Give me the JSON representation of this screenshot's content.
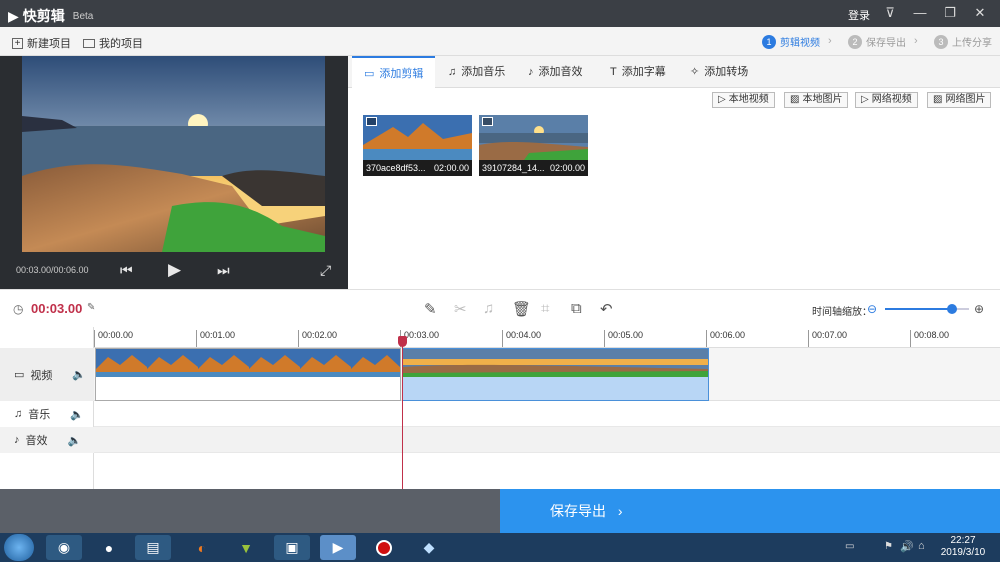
{
  "app": {
    "title": "快剪辑",
    "beta": "Beta",
    "login": "登录"
  },
  "toolbar": {
    "new_project": "新建项目",
    "my_projects": "我的项目",
    "steps": [
      {
        "num": "1",
        "label": "剪辑视频"
      },
      {
        "num": "2",
        "label": "保存导出"
      },
      {
        "num": "3",
        "label": "上传分享"
      }
    ]
  },
  "preview": {
    "time": "00:03.00/00:06.00"
  },
  "tabs": [
    "添加剪辑",
    "添加音乐",
    "添加音效",
    "添加字幕",
    "添加转场"
  ],
  "sources": [
    "本地视频",
    "本地图片",
    "网络视频",
    "网络图片"
  ],
  "clips": [
    {
      "name": "370ace8df53...",
      "duration": "02:00.00"
    },
    {
      "name": "39107284_14...",
      "duration": "02:00.00"
    }
  ],
  "editbar": {
    "current_time": "00:03.00",
    "zoom_label": "时间轴缩放：",
    "zoom_level": 0.8
  },
  "ruler": [
    "00:00.00",
    "00:01.00",
    "00:02.00",
    "00:03.00",
    "00:04.00",
    "00:05.00",
    "00:06.00",
    "00:07.00",
    "00:08.00"
  ],
  "tracks": {
    "video": "视频",
    "music": "音乐",
    "sfx": "音效"
  },
  "export_label": "保存导出",
  "clock": {
    "time": "22:27",
    "date": "2019/3/10"
  },
  "colors": {
    "accent": "#2c7be0",
    "export": "#2c93ee",
    "playhead": "#c0304a",
    "selected_clip": "#b8d6f5"
  }
}
